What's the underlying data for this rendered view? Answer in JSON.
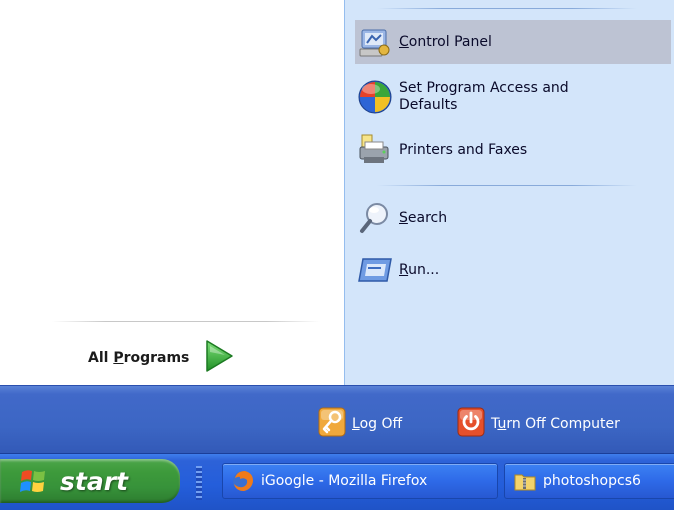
{
  "start_menu": {
    "all_programs": {
      "label_prefix": "All ",
      "label_underlined": "P",
      "label_suffix": "rograms",
      "arrow_color": "#2ea82f"
    },
    "right_items": [
      {
        "icon": "control-panel-icon",
        "underlined": "C",
        "rest": "ontrol Panel",
        "highlighted": true
      },
      {
        "icon": "windows-logo-icon",
        "line1": "Set Program Access and",
        "line2": "Defaults"
      },
      {
        "icon": "printer-icon",
        "label": "Printers and Faxes"
      },
      {
        "icon": "search-icon",
        "underlined": "S",
        "rest": "earch"
      },
      {
        "icon": "run-icon",
        "underlined": "R",
        "rest": "un..."
      }
    ],
    "footer": {
      "log_off": {
        "underlined": "L",
        "rest": "og Off",
        "icon": "key-icon"
      },
      "turn_off": {
        "prefix": "T",
        "underlined": "u",
        "rest": "rn Off Computer",
        "icon": "power-icon"
      }
    }
  },
  "taskbar": {
    "start_label": "start",
    "buttons": [
      {
        "label": "iGoogle - Mozilla Firefox",
        "icon": "firefox-icon"
      },
      {
        "label": "photoshopcs6",
        "icon": "folder-zip-icon"
      }
    ]
  },
  "colors": {
    "right_pane_bg": "#d3e5fa",
    "highlight_bg": "#bdc3d3",
    "footer_bg": "#3c66c4",
    "taskbar_bg": "#245edb",
    "start_green": "#37923a"
  }
}
